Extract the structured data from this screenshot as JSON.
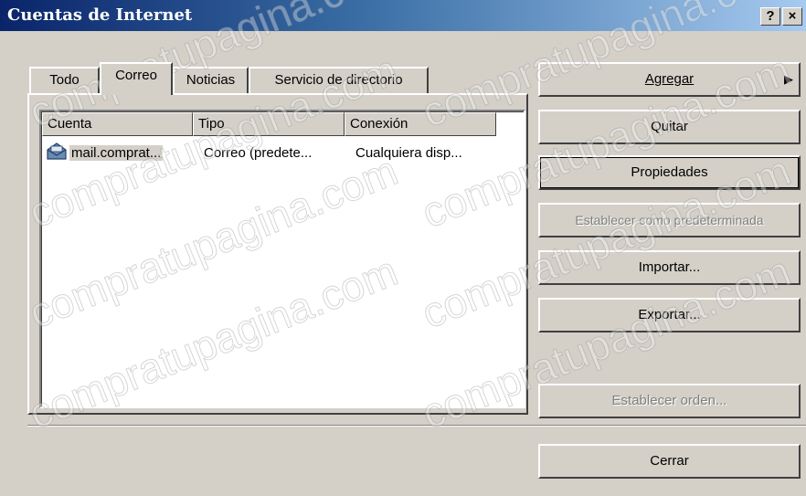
{
  "window": {
    "title": "Cuentas de Internet",
    "help_label": "?",
    "close_label": "×"
  },
  "tabs": [
    {
      "label": "Todo"
    },
    {
      "label": "Correo"
    },
    {
      "label": "Noticias"
    },
    {
      "label": "Servicio de directorio"
    }
  ],
  "list": {
    "columns": [
      "Cuenta",
      "Tipo",
      "Conexión"
    ],
    "rows": [
      {
        "cuenta": "mail.comprat...",
        "tipo": "Correo (predete...",
        "conexion": "Cualquiera disp...",
        "icon": "mail-account-icon"
      }
    ]
  },
  "buttons": {
    "agregar": "Agregar",
    "agregar_arrow": "▶",
    "quitar": "Quitar",
    "propiedades": "Propiedades",
    "predeterminada": "Establecer como predeterminada",
    "importar": "Importar...",
    "exportar": "Exportar...",
    "orden": "Establecer orden...",
    "cerrar": "Cerrar"
  },
  "watermark": "compratupagina.com"
}
